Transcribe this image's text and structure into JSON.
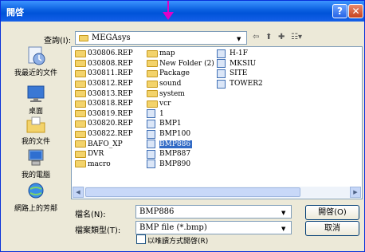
{
  "window": {
    "title": "開啓",
    "help_glyph": "?",
    "close_glyph": "✕"
  },
  "toolbar": {
    "look_in_label": "查詢(I):",
    "look_in_value": "MEGAsys",
    "dropdown_glyph": "▼"
  },
  "places": [
    {
      "label": "我最近的文件",
      "icon": "recent-documents-icon"
    },
    {
      "label": "桌面",
      "icon": "desktop-icon"
    },
    {
      "label": "我的文件",
      "icon": "my-documents-icon"
    },
    {
      "label": "我的電腦",
      "icon": "my-computer-icon"
    },
    {
      "label": "網路上的芳鄰",
      "icon": "network-places-icon"
    }
  ],
  "files": {
    "col1": [
      {
        "name": "030806.REP",
        "type": "folder"
      },
      {
        "name": "030808.REP",
        "type": "folder"
      },
      {
        "name": "030811.REP",
        "type": "folder"
      },
      {
        "name": "030812.REP",
        "type": "folder"
      },
      {
        "name": "030813.REP",
        "type": "folder"
      },
      {
        "name": "030818.REP",
        "type": "folder"
      },
      {
        "name": "030819.REP",
        "type": "folder"
      },
      {
        "name": "030820.REP",
        "type": "folder"
      },
      {
        "name": "030822.REP",
        "type": "folder"
      },
      {
        "name": "BAFO_XP",
        "type": "folder"
      },
      {
        "name": "DVR",
        "type": "folder"
      },
      {
        "name": "macro",
        "type": "folder"
      }
    ],
    "col2": [
      {
        "name": "map",
        "type": "folder"
      },
      {
        "name": "New Folder (2)",
        "type": "folder"
      },
      {
        "name": "Package",
        "type": "folder"
      },
      {
        "name": "sound",
        "type": "folder"
      },
      {
        "name": "system",
        "type": "folder"
      },
      {
        "name": "vcr",
        "type": "folder"
      },
      {
        "name": "1",
        "type": "file"
      },
      {
        "name": "BMP1",
        "type": "file"
      },
      {
        "name": "BMP100",
        "type": "file"
      },
      {
        "name": "BMP886",
        "type": "file",
        "selected": true
      },
      {
        "name": "BMP887",
        "type": "file"
      },
      {
        "name": "BMP890",
        "type": "file"
      }
    ],
    "col3": [
      {
        "name": "H-1F",
        "type": "file"
      },
      {
        "name": "MKSIU",
        "type": "file"
      },
      {
        "name": "SITE",
        "type": "file"
      },
      {
        "name": "TOWER2",
        "type": "file"
      }
    ]
  },
  "form": {
    "filename_label": "檔名(N):",
    "filename_value": "BMP886",
    "filetype_label": "檔案類型(T):",
    "filetype_value": "BMP file (*.bmp)",
    "readonly_label": "以唯讀方式開啓(R)",
    "open_button": "開啓(O)",
    "cancel_button": "取消"
  },
  "colors": {
    "titlebar": "#0a5fdf",
    "selection": "#316ac5",
    "annotation_arrow": "#e000c8"
  }
}
